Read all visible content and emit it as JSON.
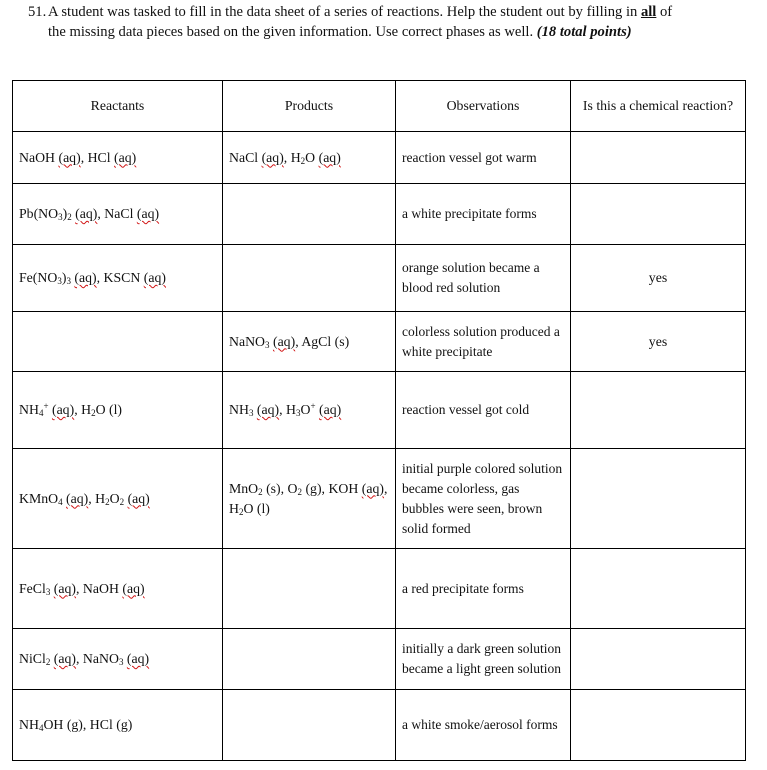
{
  "question": {
    "number": "51.",
    "text_part1": "A student was tasked to fill in the data sheet of a series of reactions.  Help the student out by filling in ",
    "emphasis": "all",
    "text_part2": " of",
    "line2": "the missing data pieces based on the given information.  Use correct phases as well. ",
    "points": "(18 total points)"
  },
  "table": {
    "headers": [
      "Reactants",
      "Products",
      "Observations",
      "Is this a chemical reaction?"
    ],
    "rows": [
      {
        "reactants": [
          [
            "NaOH "
          ],
          [
            "(aq)",
            "aq"
          ],
          [
            ", HCl "
          ],
          [
            "(aq)",
            "aq"
          ]
        ],
        "products": [
          [
            "NaCl "
          ],
          [
            "(aq)",
            "aq"
          ],
          [
            ", H"
          ],
          [
            "2",
            "sub"
          ],
          [
            "O "
          ],
          [
            "(aq)",
            "aq"
          ]
        ],
        "observation": "reaction vessel got warm",
        "chemical": ""
      },
      {
        "reactants": [
          [
            "Pb(NO"
          ],
          [
            "3",
            "sub"
          ],
          [
            ")"
          ],
          [
            "2",
            "sub"
          ],
          [
            " "
          ],
          [
            "(aq)",
            "aq"
          ],
          [
            ", NaCl "
          ],
          [
            "(aq)",
            "aq"
          ]
        ],
        "products": [],
        "observation": "a white precipitate forms",
        "chemical": ""
      },
      {
        "reactants": [
          [
            "Fe(NO"
          ],
          [
            "3",
            "sub"
          ],
          [
            ")"
          ],
          [
            "3",
            "sub"
          ],
          [
            " "
          ],
          [
            "(aq)",
            "aq"
          ],
          [
            ", KSCN "
          ],
          [
            "(aq)",
            "aq"
          ]
        ],
        "products": [],
        "observation": "orange solution became a blood red solution",
        "chemical": "yes"
      },
      {
        "reactants": [],
        "products": [
          [
            "NaNO"
          ],
          [
            "3",
            "sub"
          ],
          [
            " "
          ],
          [
            "(aq)",
            "aq"
          ],
          [
            ", AgCl (s)"
          ]
        ],
        "observation": "colorless solution produced a white precipitate",
        "chemical": "yes"
      },
      {
        "reactants": [
          [
            "NH"
          ],
          [
            "4",
            "sub"
          ],
          [
            "+",
            "sup"
          ],
          [
            " "
          ],
          [
            "(aq)",
            "aq"
          ],
          [
            ", H"
          ],
          [
            "2",
            "sub"
          ],
          [
            "O (l)"
          ]
        ],
        "products": [
          [
            "NH"
          ],
          [
            "3",
            "sub"
          ],
          [
            " "
          ],
          [
            "(aq)",
            "aq"
          ],
          [
            ", H"
          ],
          [
            "3",
            "sub"
          ],
          [
            "O"
          ],
          [
            "+",
            "sup"
          ],
          [
            " "
          ],
          [
            "(aq)",
            "aq"
          ]
        ],
        "observation": "reaction vessel got cold",
        "chemical": ""
      },
      {
        "reactants": [
          [
            "KMnO"
          ],
          [
            "4",
            "sub"
          ],
          [
            " "
          ],
          [
            "(aq)",
            "aq"
          ],
          [
            ", H"
          ],
          [
            "2",
            "sub"
          ],
          [
            "O"
          ],
          [
            "2",
            "sub"
          ],
          [
            " "
          ],
          [
            "(aq)",
            "aq"
          ]
        ],
        "products": [
          [
            "MnO"
          ],
          [
            "2",
            "sub"
          ],
          [
            " (s), O"
          ],
          [
            "2",
            "sub"
          ],
          [
            " (g), KOH "
          ],
          [
            "(aq)",
            "aq"
          ],
          [
            ", H"
          ],
          [
            "2",
            "sub"
          ],
          [
            "O (l)"
          ]
        ],
        "observation": "initial purple colored solution became colorless, gas bubbles were seen, brown solid formed",
        "chemical": ""
      },
      {
        "reactants": [
          [
            "FeCl"
          ],
          [
            "3",
            "sub"
          ],
          [
            " "
          ],
          [
            "(aq)",
            "aq"
          ],
          [
            ", NaOH "
          ],
          [
            "(aq)",
            "aq"
          ]
        ],
        "products": [],
        "observation": "a red precipitate forms",
        "chemical": ""
      },
      {
        "reactants": [
          [
            "NiCl"
          ],
          [
            "2",
            "sub"
          ],
          [
            " "
          ],
          [
            "(aq)",
            "aq"
          ],
          [
            ", NaNO"
          ],
          [
            "3",
            "sub"
          ],
          [
            " "
          ],
          [
            "(aq)",
            "aq"
          ]
        ],
        "products": [],
        "observation": "initially a dark green solution became a light green solution",
        "chemical": ""
      },
      {
        "reactants": [
          [
            "NH"
          ],
          [
            "4",
            "sub"
          ],
          [
            "OH (g), HCl (g)"
          ]
        ],
        "products": [],
        "observation": "a white smoke/aerosol forms",
        "chemical": ""
      }
    ]
  }
}
